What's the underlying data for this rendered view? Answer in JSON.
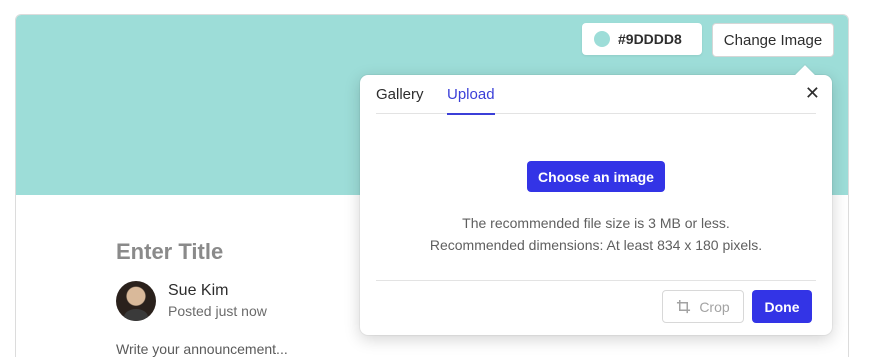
{
  "colors": {
    "cover": "#9DDDD8",
    "accent": "#3334e6"
  },
  "cover": {
    "color_hex": "#9DDDD8",
    "change_image_label": "Change Image"
  },
  "post": {
    "title_placeholder": "Enter Title",
    "author_name": "Sue Kim",
    "posted_meta": "Posted just now",
    "body_placeholder": "Write your announcement..."
  },
  "image_popover": {
    "tabs": [
      {
        "label": "Gallery",
        "active": false
      },
      {
        "label": "Upload",
        "active": true
      }
    ],
    "close_icon": "close-icon",
    "choose_button": "Choose an image",
    "hint_size": "The recommended file size is 3 MB or less.",
    "hint_dimensions": "Recommended dimensions: At least 834 x 180 pixels.",
    "crop_label": "Crop",
    "crop_icon": "crop-icon",
    "done_label": "Done"
  }
}
